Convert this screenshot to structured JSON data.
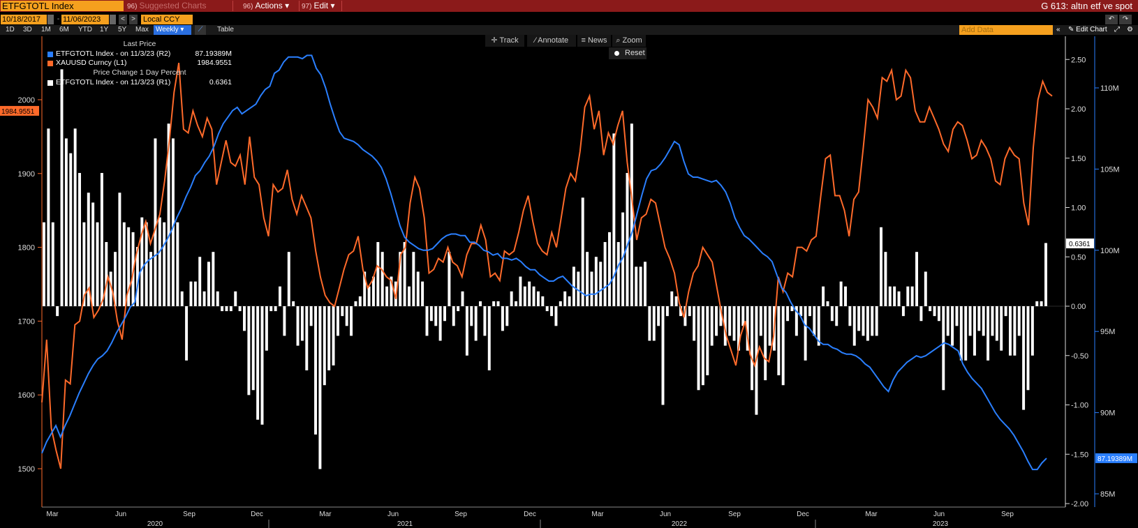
{
  "topbar": {
    "ticker": "ETFGTOTL Index",
    "suggested_num": "96)",
    "suggested": "Suggested Charts",
    "actions_num": "96)",
    "actions": "Actions ▾",
    "edit_num": "97)",
    "edit": "Edit ▾",
    "title": "G 613: altın etf ve spot"
  },
  "controls": {
    "start_date": "10/18/2017",
    "end_date": "11/06/2023",
    "currency": "Local CCY",
    "ranges": [
      "1D",
      "3D",
      "1M",
      "6M",
      "YTD",
      "1Y",
      "5Y",
      "Max"
    ],
    "period": "Weekly ▾",
    "table": "Table",
    "add_data_placeholder": "Add Data",
    "edit_chart": "Edit Chart"
  },
  "tools": {
    "track": "Track",
    "annotate": "Annotate",
    "news": "News",
    "zoom": "Zoom",
    "reset": "Reset"
  },
  "legend": {
    "header1": "Last Price",
    "header2": "Price Change 1 Day Percent",
    "rows": [
      {
        "name": "ETFGTOTL Index -  on 11/3/23  (R2)",
        "value": "87.19389M",
        "color": "#2a7fff"
      },
      {
        "name": "XAUUSD Curncy  (L1)",
        "value": "1984.9551",
        "color": "#ff6a2a"
      },
      {
        "name": "ETFGTOTL Index -  on 11/3/23  (R1)",
        "value": "0.6361",
        "color": "#ffffff"
      }
    ]
  },
  "chart_data": {
    "type": "line",
    "x_tick_labels": [
      "Mar",
      "Jun",
      "Sep",
      "Dec",
      "Mar",
      "Jun",
      "Sep",
      "Dec",
      "Mar",
      "Jun",
      "Sep",
      "Dec",
      "Mar",
      "Jun",
      "Sep"
    ],
    "year_labels": [
      "2020",
      "2021",
      "2022",
      "2023"
    ],
    "left_axis": {
      "ticks": [
        "1500",
        "1600",
        "1700",
        "1800",
        "1900",
        "2000"
      ],
      "range": [
        1440,
        2090
      ]
    },
    "right1_axis": {
      "ticks": [
        "-2.00",
        "-1.50",
        "-1.00",
        "-0.50",
        "0.00",
        "0.50",
        "1.00",
        "1.50",
        "2.00",
        "2.50"
      ],
      "range": [
        -2.0,
        2.7
      ]
    },
    "right2_axis": {
      "ticks": [
        "85M",
        "90M",
        "95M",
        "100M",
        "105M",
        "110M"
      ],
      "range": [
        84.3,
        112.3
      ]
    },
    "last_labels": {
      "gold": "1984.9551",
      "pct": "0.6361",
      "etf": "87.19389M"
    },
    "series": [
      {
        "name": "XAUUSD Curncy (L1)",
        "axis": "left",
        "color": "#ff6a2a",
        "values": [
          1590,
          1675,
          1555,
          1525,
          1500,
          1620,
          1615,
          1695,
          1700,
          1735,
          1745,
          1705,
          1715,
          1730,
          1760,
          1740,
          1700,
          1675,
          1735,
          1755,
          1790,
          1815,
          1835,
          1805,
          1825,
          1845,
          1890,
          1945,
          2010,
          2050,
          1960,
          1955,
          1985,
          1965,
          1950,
          1975,
          1960,
          1885,
          1915,
          1945,
          1915,
          1910,
          1925,
          1885,
          1950,
          1895,
          1885,
          1840,
          1815,
          1885,
          1875,
          1880,
          1905,
          1865,
          1845,
          1870,
          1855,
          1840,
          1795,
          1760,
          1735,
          1725,
          1720,
          1745,
          1770,
          1790,
          1795,
          1815,
          1770,
          1745,
          1755,
          1775,
          1770,
          1760,
          1755,
          1730,
          1790,
          1800,
          1860,
          1895,
          1880,
          1840,
          1765,
          1770,
          1785,
          1780,
          1800,
          1780,
          1775,
          1760,
          1790,
          1805,
          1805,
          1830,
          1810,
          1760,
          1765,
          1755,
          1795,
          1790,
          1795,
          1820,
          1850,
          1870,
          1835,
          1805,
          1795,
          1790,
          1820,
          1800,
          1840,
          1880,
          1900,
          1890,
          1930,
          1990,
          2005,
          1960,
          1985,
          1925,
          1955,
          1940,
          1965,
          1985,
          1915,
          1865,
          1810,
          1840,
          1845,
          1865,
          1860,
          1830,
          1800,
          1785,
          1765,
          1725,
          1705,
          1740,
          1765,
          1775,
          1800,
          1790,
          1780,
          1745,
          1710,
          1680,
          1660,
          1640,
          1680,
          1700,
          1655,
          1640,
          1665,
          1650,
          1645,
          1680,
          1760,
          1740,
          1765,
          1760,
          1800,
          1800,
          1795,
          1810,
          1815,
          1870,
          1920,
          1925,
          1870,
          1870,
          1850,
          1815,
          1865,
          1875,
          1935,
          2000,
          1990,
          1975,
          2030,
          2025,
          2040,
          2000,
          2005,
          2040,
          2030,
          1985,
          1970,
          1970,
          1990,
          1975,
          1960,
          1940,
          1930,
          1960,
          1970,
          1965,
          1945,
          1920,
          1925,
          1945,
          1935,
          1920,
          1890,
          1885,
          1920,
          1935,
          1925,
          1920,
          1860,
          1830,
          1935,
          2000,
          2025,
          2010,
          2005
        ],
        "last": 1984.9551
      },
      {
        "name": "ETFGTOTL Index (R2)",
        "axis": "right2",
        "color": "#2a7fff",
        "values": [
          87.5,
          88.2,
          88.7,
          89.2,
          88.5,
          89.2,
          89.8,
          90.5,
          91.2,
          91.8,
          92.4,
          92.9,
          93.3,
          93.5,
          93.8,
          94.3,
          94.9,
          95.4,
          95.9,
          96.5,
          96.8,
          98.6,
          99.1,
          99.4,
          99.6,
          99.8,
          100.2,
          100.7,
          101.3,
          102.0,
          102.6,
          103.3,
          103.9,
          104.6,
          104.9,
          105.4,
          105.8,
          106.4,
          107.2,
          107.8,
          108.2,
          108.6,
          108.8,
          108.4,
          108.6,
          108.8,
          109.0,
          109.5,
          109.9,
          110.1,
          110.9,
          111.1,
          111.6,
          111.9,
          111.9,
          111.9,
          111.8,
          112.0,
          112.0,
          111.2,
          110.8,
          110.0,
          109.0,
          108.1,
          107.3,
          106.9,
          106.8,
          106.7,
          106.5,
          106.2,
          106.0,
          105.8,
          105.5,
          105.1,
          104.4,
          103.5,
          102.5,
          101.5,
          100.8,
          100.5,
          100.3,
          100.1,
          100.0,
          100.0,
          100.1,
          100.4,
          100.7,
          100.9,
          101.0,
          101.0,
          100.9,
          100.9,
          100.5,
          100.5,
          100.3,
          100.0,
          99.9,
          99.7,
          99.8,
          99.5,
          99.5,
          99.4,
          99.5,
          99.3,
          99.0,
          98.8,
          98.8,
          98.5,
          98.3,
          98.1,
          98.1,
          98.3,
          98.4,
          98.1,
          97.8,
          97.6,
          97.4,
          97.2,
          97.3,
          97.3,
          97.5,
          97.7,
          97.9,
          98.4,
          99.1,
          99.6,
          100.4,
          101.2,
          102.3,
          103.4,
          104.4,
          104.9,
          105.0,
          105.3,
          105.7,
          106.2,
          106.7,
          106.5,
          105.5,
          104.7,
          104.5,
          104.5,
          104.4,
          104.3,
          104.2,
          104.3,
          104.0,
          103.6,
          102.9,
          102.0,
          101.4,
          100.9,
          100.7,
          100.4,
          100.1,
          99.8,
          99.6,
          99.3,
          98.5,
          97.7,
          97.4,
          96.8,
          96.3,
          96.0,
          95.4,
          95.2,
          94.8,
          94.4,
          94.2,
          94.2,
          94.0,
          93.9,
          93.7,
          93.6,
          93.6,
          93.5,
          93.3,
          93.0,
          92.8,
          92.4,
          92.0,
          91.6,
          91.3,
          92.0,
          92.5,
          92.8,
          93.1,
          93.3,
          93.5,
          93.4,
          93.5,
          93.7,
          93.9,
          94.1,
          94.3,
          94.2,
          94.0,
          93.8,
          93.0,
          92.5,
          92.1,
          91.8,
          91.5,
          91.0,
          90.5,
          90.0,
          89.6,
          89.3,
          89.0,
          88.6,
          88.1,
          87.6,
          87.0,
          86.5,
          86.5,
          86.9,
          87.19
        ],
        "last": 87.19389
      },
      {
        "name": "ETFGTOTL Index (R1)",
        "axis": "right1",
        "type": "bar",
        "color": "#ffffff",
        "values": [
          0.85,
          1.8,
          0.85,
          -0.1,
          2.4,
          1.7,
          1.55,
          1.8,
          1.35,
          0.85,
          1.15,
          1.05,
          0.85,
          1.35,
          0.65,
          0.35,
          0.55,
          1.15,
          0.85,
          0.8,
          0.75,
          0.6,
          0.9,
          0.85,
          0.55,
          1.7,
          0.9,
          0.85,
          1.85,
          1.7,
          0.85,
          0.15,
          -0.55,
          0.25,
          0.25,
          0.5,
          0.15,
          0.45,
          0.55,
          0.15,
          -0.05,
          -0.05,
          -0.05,
          0.15,
          -0.05,
          -0.25,
          -0.9,
          -0.85,
          -1.15,
          -1.2,
          -0.45,
          -0.05,
          -0.05,
          0.2,
          -0.3,
          0.55,
          0.05,
          -0.4,
          -0.35,
          -0.65,
          -0.2,
          -1.3,
          -1.65,
          -0.8,
          -0.65,
          -0.6,
          -0.3,
          -0.1,
          -0.2,
          -0.3,
          0.05,
          0.1,
          0.35,
          0.2,
          0.3,
          0.65,
          0.55,
          0.2,
          0.3,
          0.25,
          0.55,
          0.65,
          0.2,
          0.55,
          0.35,
          0.25,
          -0.3,
          -0.15,
          -0.2,
          -0.35,
          -0.15,
          0.55,
          -0.2,
          -0.05,
          0.15,
          -0.5,
          -0.2,
          -0.35,
          0.05,
          -0.3,
          -0.65,
          0.05,
          0.05,
          -0.25,
          -0.2,
          0.15,
          0.05,
          0.3,
          0.2,
          0.25,
          0.2,
          0.15,
          0.1,
          -0.05,
          -0.1,
          -0.2,
          0.05,
          0.15,
          0.1,
          0.4,
          0.35,
          1.1,
          0.55,
          0.35,
          0.5,
          0.45,
          0.65,
          0.75,
          1.75,
          0.65,
          0.95,
          1.35,
          1.85,
          0.4,
          0.4,
          0.45,
          -0.35,
          -0.35,
          -0.2,
          -1.0,
          -0.1,
          0.15,
          0.1,
          -0.1,
          -0.2,
          -0.1,
          -0.35,
          -0.85,
          -0.8,
          -0.7,
          -0.4,
          -0.3,
          -0.2,
          -0.4,
          -0.3,
          -0.35,
          -0.45,
          -0.2,
          -0.45,
          -0.85,
          -1.1,
          -0.3,
          -0.75,
          -0.4,
          -0.45,
          -0.7,
          -0.8,
          -0.15,
          -0.05,
          -0.3,
          -0.1,
          -0.55,
          -0.1,
          -0.3,
          -0.4,
          0.2,
          0.05,
          -0.15,
          -0.2,
          0.25,
          0.2,
          -0.2,
          -0.4,
          -0.25,
          -0.3,
          -0.35,
          -0.3,
          -0.3,
          0.8,
          0.55,
          0.2,
          0.2,
          0.15,
          -0.1,
          0.2,
          0.2,
          0.55,
          -0.15,
          0.35,
          -0.05,
          -0.1,
          -0.15,
          -0.85,
          -0.3,
          -0.4,
          -0.2,
          -0.55,
          -0.55,
          -0.3,
          -0.5,
          -0.25,
          -0.3,
          -0.55,
          -0.3,
          -0.35,
          -0.45,
          -0.1,
          -0.5,
          -0.5,
          -0.3,
          -1.05,
          -0.85,
          -0.5,
          0.05,
          0.05,
          0.64
        ],
        "last": 0.6361
      }
    ]
  }
}
